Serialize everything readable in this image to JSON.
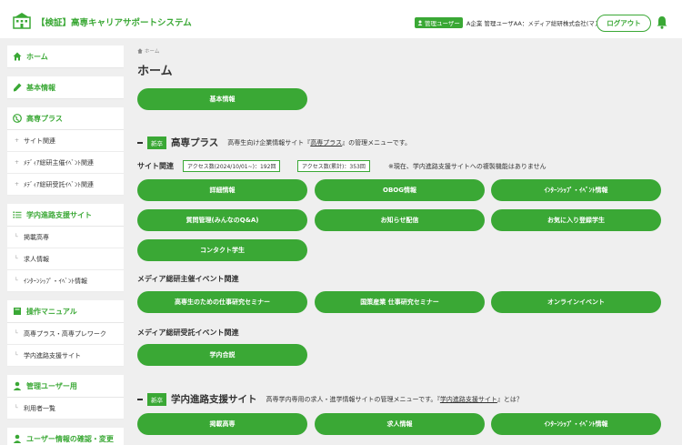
{
  "header": {
    "title": "【検証】高専キャリアサポートシステム",
    "role_badge": "管理ユーザー",
    "user_name": "A企業 管理ユーザAA：メディア総研株式会社(マスタ)",
    "logout_label": "ログアウト"
  },
  "sidebar": {
    "home": "ホーム",
    "basic": "基本情報",
    "kosen_plus": {
      "label": "高専プラス",
      "items": [
        "サイト関連",
        "ﾒﾃﾞｨｱ総研主催ｲﾍﾞﾝﾄ関連",
        "ﾒﾃﾞｨｱ総研受託ｲﾍﾞﾝﾄ関連"
      ]
    },
    "shinro": {
      "label": "学内進路支援サイト",
      "items": [
        "掲載高専",
        "求人情報",
        "ｲﾝﾀｰﾝｼｯﾌﾟ・ｲﾍﾞﾝﾄ情報"
      ]
    },
    "manual": {
      "label": "操作マニュアル",
      "items": [
        "高専プラス・高専プレワーク",
        "学内進路支援サイト"
      ]
    },
    "admin_users": {
      "label": "管理ユーザー用",
      "items": [
        "利用者一覧"
      ]
    },
    "partial_label": "ユーザー情報の確認・変更"
  },
  "main": {
    "breadcrumb": "ホーム",
    "title": "ホーム",
    "basic_btn": "基本情報",
    "kosen_plus": {
      "badge": "新卒",
      "title": "高専プラス",
      "desc_prefix": "高専生向け企業情報サイト『",
      "desc_link": "高専プラス",
      "desc_suffix": "』の管理メニューです。",
      "site_label": "サイト関連",
      "access_period": "アクセス数(2024/10/01~)：192回",
      "access_total": "アクセス数(累計)：353回",
      "note": "※現在、学内進路支援サイトへの複製機能はありません",
      "site_buttons": [
        "詳細情報",
        "OBOG情報",
        "ｲﾝﾀｰﾝｼｯﾌﾟ・ｲﾍﾞﾝﾄ情報",
        "質問管理(みんなのQ&A)",
        "お知らせ配信",
        "お気に入り登録学生",
        "コンタクト学生"
      ],
      "host_label": "メディア総研主催イベント関連",
      "host_buttons": [
        "高専生のための仕事研究セミナー",
        "国策産業 仕事研究セミナー",
        "オンラインイベント"
      ],
      "trust_label": "メディア総研受託イベント関連",
      "trust_buttons": [
        "学内合説"
      ]
    },
    "shinro": {
      "badge": "新卒",
      "title": "学内進路支援サイト",
      "desc_prefix": "高専学内専用の求人・進学情報サイトの管理メニューです。『",
      "desc_link": "学内進路支援サイト",
      "desc_suffix": "』とは？",
      "buttons": [
        "掲載高専",
        "求人情報",
        "ｲﾝﾀｰﾝｼｯﾌﾟ・ｲﾍﾞﾝﾄ情報"
      ]
    }
  },
  "colors": {
    "accent": "#3aa835",
    "background": "#efefef"
  }
}
